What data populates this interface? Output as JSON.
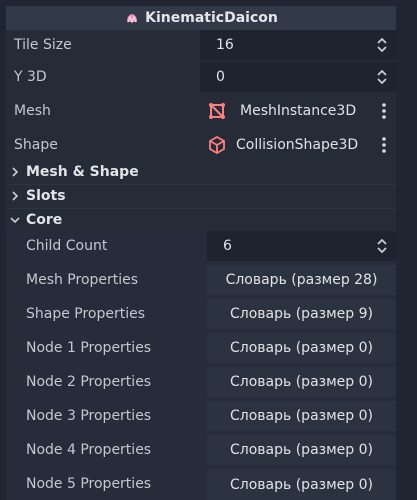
{
  "header": {
    "title": "KinematicDaicon",
    "icon": "kinematic-node-icon",
    "icon_color": "#e88fb4"
  },
  "properties": {
    "tile_size": {
      "label": "Tile Size",
      "value": "16"
    },
    "y_3d": {
      "label": "Y 3D",
      "value": "0"
    },
    "mesh": {
      "label": "Mesh",
      "value": "MeshInstance3D",
      "icon": "mesh-instance-icon",
      "icon_color": "#fc7f7f"
    },
    "shape": {
      "label": "Shape",
      "value": "CollisionShape3D",
      "icon": "collision-shape-icon",
      "icon_color": "#fc7f7f"
    }
  },
  "sections": {
    "mesh_shape": {
      "label": "Mesh & Shape",
      "expanded": false
    },
    "slots": {
      "label": "Slots",
      "expanded": false
    },
    "core": {
      "label": "Core",
      "expanded": true
    }
  },
  "core": {
    "child_count": {
      "label": "Child Count",
      "value": "6"
    },
    "mesh_properties": {
      "label": "Mesh Properties",
      "value": "Словарь (размер 28)"
    },
    "shape_properties": {
      "label": "Shape Properties",
      "value": "Словарь (размер 9)"
    },
    "node1": {
      "label": "Node 1 Properties",
      "value": "Словарь (размер 0)"
    },
    "node2": {
      "label": "Node 2 Properties",
      "value": "Словарь (размер 0)"
    },
    "node3": {
      "label": "Node 3 Properties",
      "value": "Словарь (размер 0)"
    },
    "node4": {
      "label": "Node 4 Properties",
      "value": "Словарь (размер 0)"
    },
    "node5": {
      "label": "Node 5 Properties",
      "value": "Словарь (размер 0)"
    }
  }
}
